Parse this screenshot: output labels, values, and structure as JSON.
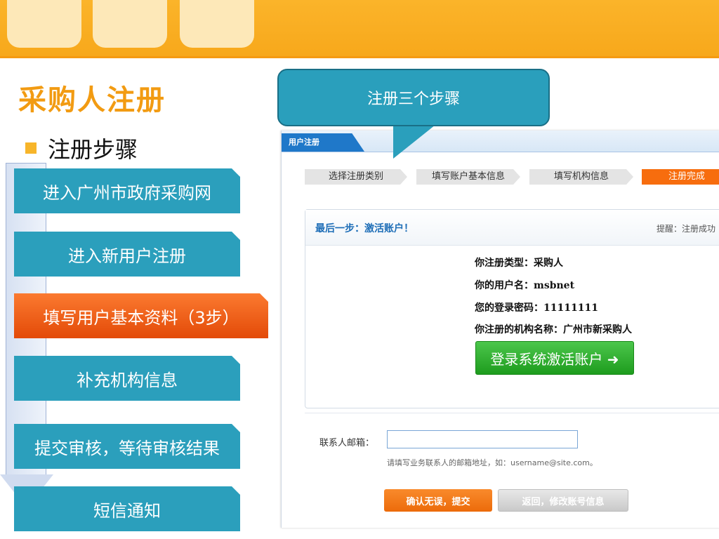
{
  "slide": {
    "title": "采购人注册",
    "subtitle": "注册步骤",
    "steps": [
      "进入广州市政府采购网",
      "进入新用户注册",
      "填写用户基本资料（3步）",
      "补充机构信息",
      "提交审核，等待审核结果",
      "短信通知"
    ],
    "callout": "注册三个步骤"
  },
  "screenshot": {
    "tab": "用户注册",
    "progress": [
      "选择注册类别",
      "填写账户基本信息",
      "填写机构信息",
      "注册完成"
    ],
    "panel_title": "最后一步：激活账户！",
    "panel_tip": "提醒：注册成功",
    "info": [
      "你注册类型：采购人",
      "你的用户名：msbnet",
      "您的登录密码：11111111",
      "你注册的机构名称：广州市新采购人"
    ],
    "activate_button": "登录系统激活账户 ➜",
    "email_label": "联系人邮箱：",
    "email_hint": "请填写业务联系人的邮箱地址，如：username@site.com。",
    "confirm_button": "确认无误，提交",
    "back_button": "返回，修改账号信息"
  },
  "colors": {
    "accent_orange": "#f29b12",
    "step_blue": "#2b9fbc",
    "step_active": "#e34a08",
    "activate_green": "#1e9c1e"
  }
}
